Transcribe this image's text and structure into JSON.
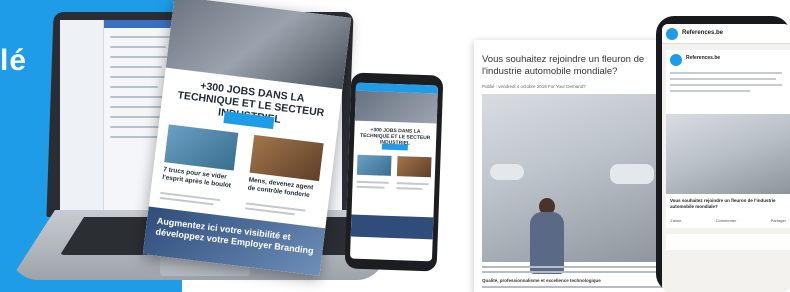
{
  "band": {
    "text": "lé",
    "color": "#1e9ce8"
  },
  "newsletter": {
    "title": "+300 JOBS DANS LA TECHNIQUE ET LE SECTEUR INDUSTRIEL",
    "card1_title": "7 trucs pour se vider l'esprit après le boulot",
    "card2_title": "Mens, devenez agent de contrôle fonderie",
    "banner_text": "Augmentez ici votre visibilité et développez votre Employer Branding"
  },
  "phone_newsletter": {
    "brand": "References",
    "title": "+300 JOBS DANS LA TECHNIQUE ET LE SECTEUR INDUSTRIEL"
  },
  "article": {
    "title": "Vous souhaitez rejoindre un fleuron de l'industrie automobile mondiale?",
    "meta": "Publié : vendredi 4 octobre 2019     For Your Demand?",
    "subheading": "Qualité, professionnalisme et excellence technologique"
  },
  "linkedin": {
    "account": "References.be",
    "post_author": "References.be",
    "caption": "Vous souhaitez rejoindre un fleuron de l'industrie automobile mondiale?",
    "actions": [
      "J'aime",
      "Commenter",
      "Partager"
    ]
  }
}
